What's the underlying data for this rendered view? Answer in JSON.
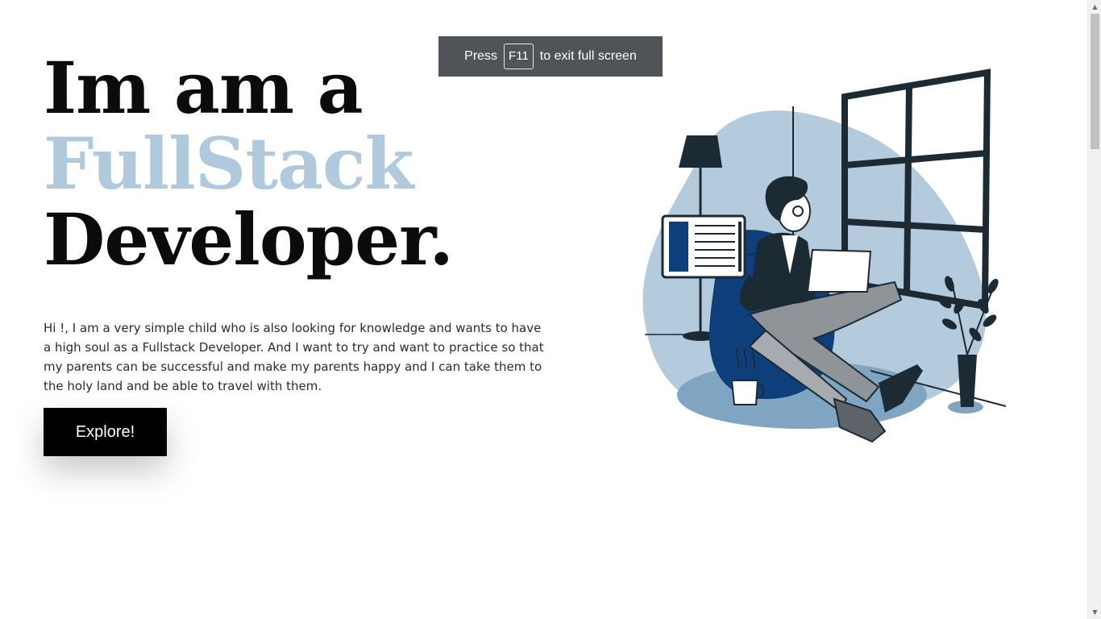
{
  "hero": {
    "line1": "Im am a",
    "line2": "FullStack",
    "line3": "Developer.",
    "description": "Hi !, I am a very simple child who is also looking for knowledge and wants to have a high soul as a Fullstack Developer. And I want to try and want to practice so that my parents can be successful and make my parents happy and I can take them to the holy land and be able to travel with them.",
    "button_label": "Explore!"
  },
  "fullscreen_toast": {
    "press": "Press",
    "key": "F11",
    "suffix": "to exit full screen"
  },
  "illustration": {
    "subject": "man sitting in bean bag with laptop beside window"
  },
  "colors": {
    "accent": "#b0c9dc",
    "text": "#0b0b0b",
    "illustration_light_blue": "#b4cbdd",
    "illustration_dark": "#1b2a33",
    "illustration_navy": "#0f3f7a"
  }
}
